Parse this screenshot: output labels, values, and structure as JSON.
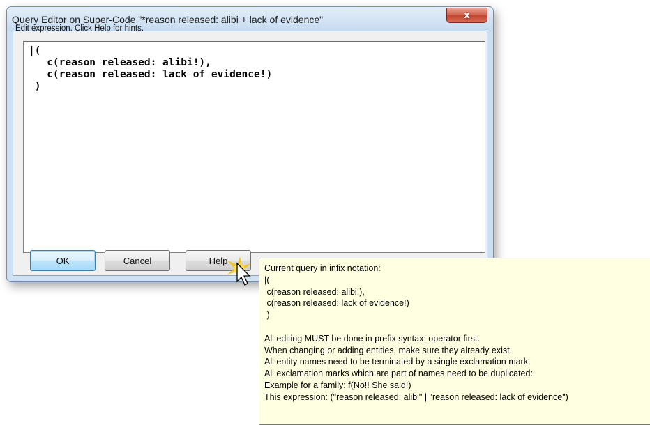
{
  "window": {
    "title": "Query Editor on Super-Code \"*reason released: alibi +  lack of evidence\"",
    "close_label": "x"
  },
  "dialog": {
    "hint": "Edit expression. Click Help for hints.",
    "editor_text": "|(\n   c(reason released: alibi!),\n   c(reason released: lack of evidence!)\n )"
  },
  "buttons": {
    "ok": "OK",
    "cancel": "Cancel",
    "help": "Help"
  },
  "tooltip": {
    "lines": [
      "Current query in infix notation:",
      "|(",
      " c(reason released: alibi!),",
      " c(reason released: lack of evidence!)",
      " )",
      "",
      "All editing MUST be done in prefix syntax: operator first.",
      "When changing or adding entities, make sure they already exist.",
      "All entity names need to be terminated by a single exclamation mark.",
      "All exclamation marks which are part of names need to be duplicated:",
      "Example for a family: f(No!! She said!)",
      "This expression: (\"reason released: alibi\" | \"reason released: lack of evidence\")"
    ]
  },
  "colors": {
    "tooltip_bg": "#ffffe1",
    "close_red": "#c14530",
    "frame_blue": "#cfe0f1"
  }
}
